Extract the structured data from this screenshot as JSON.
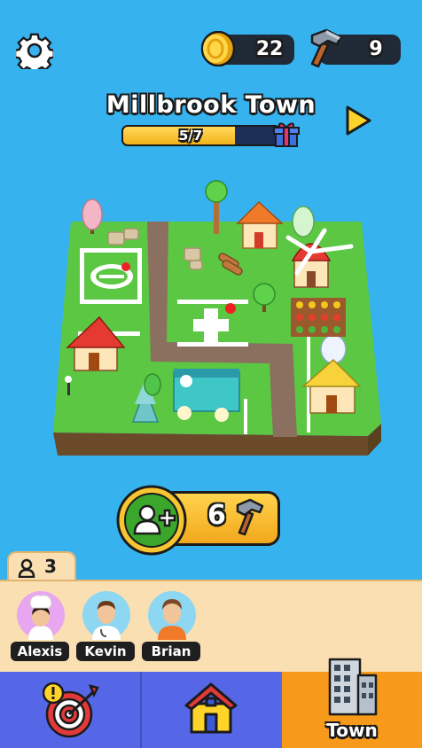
{
  "header": {
    "coins": "22",
    "hammers": "9"
  },
  "town": {
    "name": "Millbrook Town",
    "progress_label": "5/7",
    "progress_current": 5,
    "progress_total": 7
  },
  "add_resident": {
    "cost": "6"
  },
  "residents": {
    "count": "3",
    "list": [
      {
        "name": "Alexis"
      },
      {
        "name": "Kevin"
      },
      {
        "name": "Brian"
      }
    ]
  },
  "nav": {
    "quests_icon": "target-alert-icon",
    "home_icon": "house-icon",
    "town_icon": "building-icon",
    "town_label": "Town"
  },
  "colors": {
    "sky": "#36b3ef",
    "nav_blue": "#5567e6",
    "nav_active": "#f79a1b",
    "panel": "#f9dfb2",
    "gold": "#f7c531",
    "green_button": "#3aa62c"
  }
}
